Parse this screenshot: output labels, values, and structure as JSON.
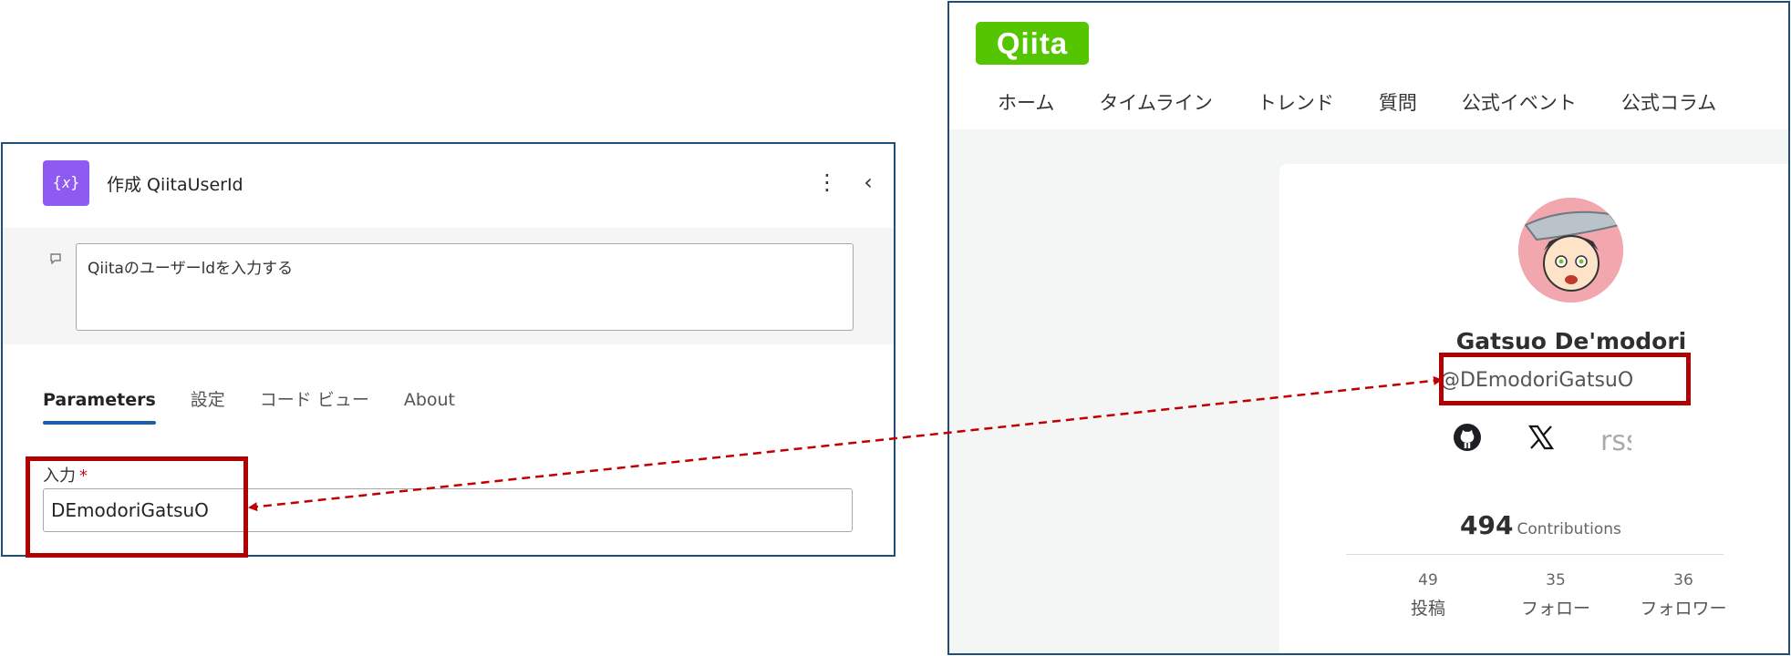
{
  "left_panel": {
    "action_icon": "braces-variable-icon",
    "action_icon_glyph": "{𝑥}",
    "title": "作成 QiitaUserId",
    "more_glyph": "⋮",
    "collapse_glyph": "‹",
    "comment_icon_glyph": "🗨",
    "comment": "Qiitaのユーザーldを入力する",
    "tabs": [
      {
        "label": "Parameters",
        "active": true
      },
      {
        "label": "設定",
        "active": false
      },
      {
        "label": "コード ビュー",
        "active": false
      },
      {
        "label": "About",
        "active": false
      }
    ],
    "input_label": "入力",
    "required_marker": "*",
    "input_value": "DEmodoriGatsuO"
  },
  "qiita": {
    "logo": "Qiita",
    "nav": [
      "ホーム",
      "タイムライン",
      "トレンド",
      "質問",
      "公式イベント",
      "公式コラム"
    ],
    "profile": {
      "name": "Gatsuo De'modori",
      "user_id": "@DEmodoriGatsuO",
      "socials": [
        {
          "icon": "github-icon",
          "glyph": "⬤"
        },
        {
          "icon": "x-icon",
          "glyph": "𝕏"
        },
        {
          "icon": "rss-icon",
          "glyph": "rss"
        }
      ],
      "contributions_value": "494",
      "contributions_label": "Contributions",
      "stats": [
        {
          "value": "49",
          "label": "投稿"
        },
        {
          "value": "35",
          "label": "フォロー"
        },
        {
          "value": "36",
          "label": "フォロワー"
        }
      ]
    }
  },
  "colors": {
    "highlight": "#b00000",
    "arrow": "#c00000",
    "qiita_green": "#55c500",
    "tab_accent": "#1f5ea8",
    "action_icon_bg": "#8f5af2"
  }
}
